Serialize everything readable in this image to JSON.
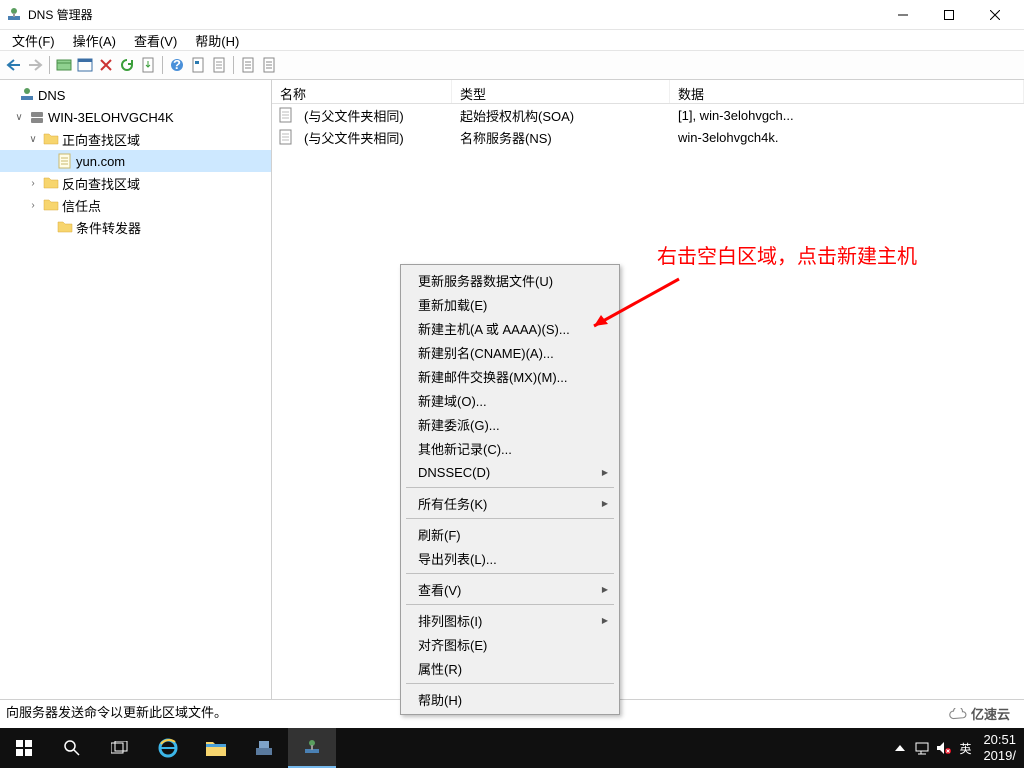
{
  "window": {
    "title": "DNS 管理器"
  },
  "menubar": [
    "文件(F)",
    "操作(A)",
    "查看(V)",
    "帮助(H)"
  ],
  "tree": {
    "root": "DNS",
    "server": "WIN-3ELOHVGCH4K",
    "fwd": "正向查找区域",
    "zone": "yun.com",
    "rev": "反向查找区域",
    "trust": "信任点",
    "cond": "条件转发器"
  },
  "columns": {
    "c1": "名称",
    "c2": "类型",
    "c3": "数据"
  },
  "rows": [
    {
      "name": "(与父文件夹相同)",
      "type": "起始授权机构(SOA)",
      "data": "[1], win-3elohvgch..."
    },
    {
      "name": "(与父文件夹相同)",
      "type": "名称服务器(NS)",
      "data": "win-3elohvgch4k."
    }
  ],
  "ctx": {
    "g1": [
      "更新服务器数据文件(U)",
      "重新加载(E)",
      "新建主机(A 或 AAAA)(S)...",
      "新建别名(CNAME)(A)...",
      "新建邮件交换器(MX)(M)...",
      "新建域(O)...",
      "新建委派(G)...",
      "其他新记录(C)...",
      "DNSSEC(D)"
    ],
    "g2": [
      "所有任务(K)"
    ],
    "g3": [
      "刷新(F)",
      "导出列表(L)..."
    ],
    "g4": [
      "查看(V)"
    ],
    "g5": [
      "排列图标(I)",
      "对齐图标(E)",
      "属性(R)"
    ],
    "g6": [
      "帮助(H)"
    ]
  },
  "annotation": "右击空白区域，点击新建主机",
  "status": "向服务器发送命令以更新此区域文件。",
  "tray": {
    "time": "20:51",
    "date": "2019/",
    "ime": "英"
  },
  "watermark": "亿速云"
}
